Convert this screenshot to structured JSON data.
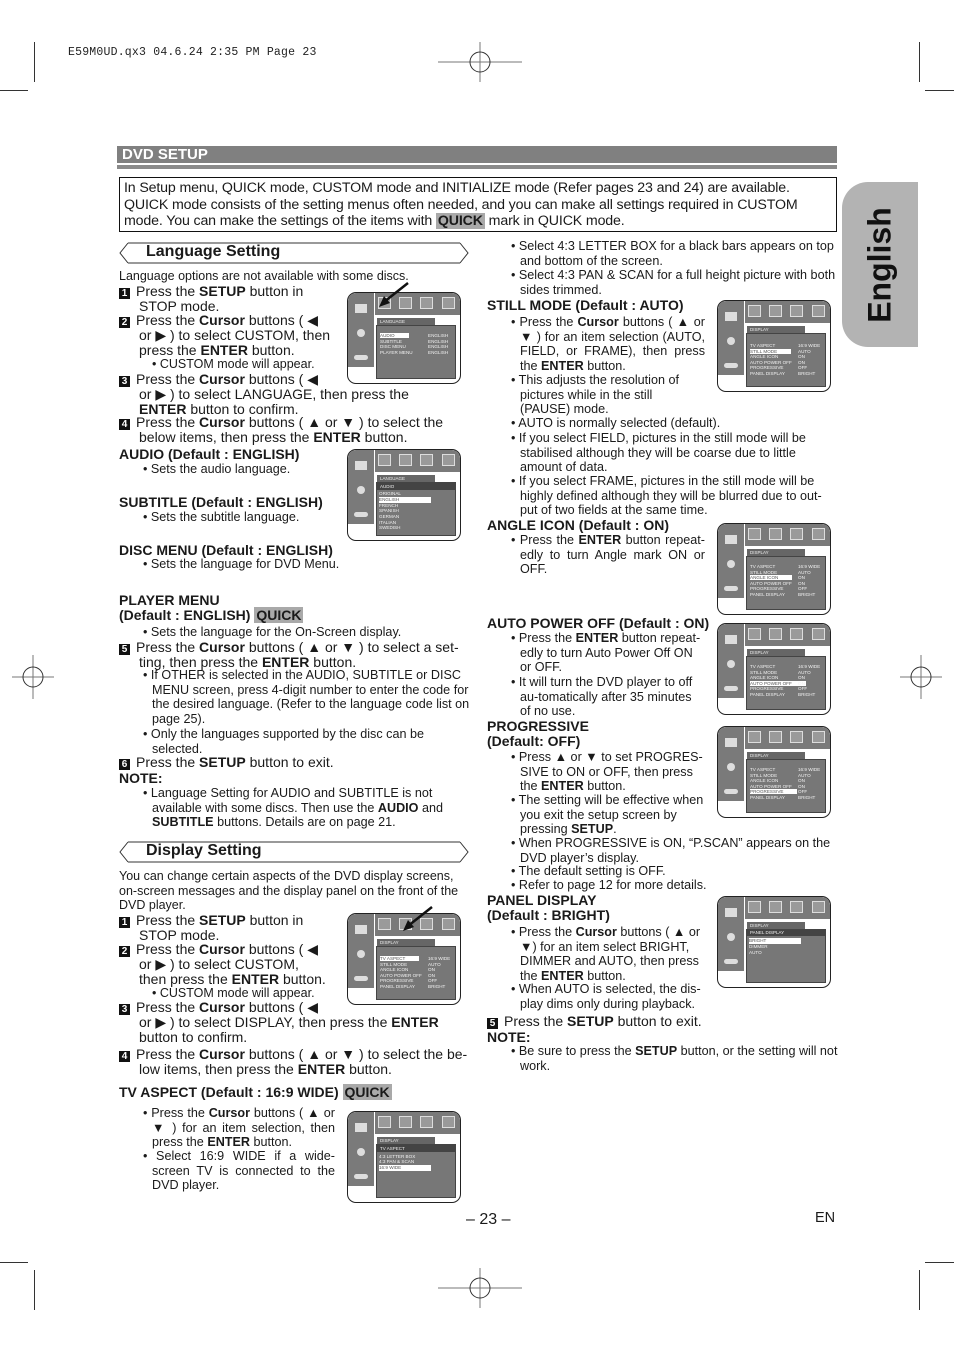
{
  "slug": "E59M0UD.qx3  04.6.24  2:35 PM  Page 23",
  "section_title": "DVD SETUP",
  "side_tab": "English",
  "intro": {
    "line1": "In Setup menu, QUICK mode, CUSTOM mode and INITIALIZE mode (Refer pages 23 and 24) are available.",
    "line2": "QUICK mode consists of the setting menus often needed, and you can make all settings required in CUSTOM",
    "line3a": "mode. You can make the settings of the items with",
    "quick": "QUICK",
    "line3b": "mark in QUICK mode."
  },
  "quick_badge": "QUICK",
  "language": {
    "title": "Language Setting",
    "note_top": "Language options are not available with some discs.",
    "steps": [
      {
        "n": "1",
        "a": "Press the ",
        "b": "SETUP",
        "c": " button in",
        "d": "STOP mode."
      },
      {
        "n": "2",
        "a": "Press the ",
        "b": "Cursor",
        "c": " buttons ( ◀",
        "d": "or ▶ ) to select CUSTOM, then",
        "e": "press the ",
        "f": "ENTER",
        "g": " button."
      },
      {
        "n": "3",
        "a": "Press the ",
        "b": "Cursor",
        "c": " buttons ( ◀",
        "d": "or ▶ ) to select LANGUAGE, then press the",
        "e": "ENTER",
        "f": " button to confirm."
      },
      {
        "n": "4",
        "a": "Press the ",
        "b": "Cursor",
        "c": " buttons ( ▲ or ▼ ) to select the",
        "d": "below items, then press the ",
        "e": "ENTER",
        "f": " button."
      },
      {
        "n": "5",
        "a": "Press the ",
        "b": "Cursor",
        "c": " buttons ( ▲ or ▼ ) to select a set-",
        "d": "ting, then press the ",
        "e": "ENTER",
        "f": " button."
      },
      {
        "n": "6",
        "a": "Press the ",
        "b": "SETUP",
        "c": " button to exit."
      }
    ],
    "custom_note": "• CUSTOM mode will appear.",
    "items": [
      {
        "head": "AUDIO",
        "def": " (Default : ENGLISH)",
        "desc": "• Sets the audio language."
      },
      {
        "head": "SUBTITLE",
        "def": " (Default : ENGLISH)",
        "desc": "• Sets the subtitle language."
      },
      {
        "head": "DISC MENU",
        "def": " (Default : ENGLISH)",
        "desc": "• Sets the language for DVD Menu."
      },
      {
        "head": "PLAYER MENU",
        "def": "(Default : ENGLISH)",
        "desc": "• Sets the language for the On-Screen display."
      }
    ],
    "step5_bullets": [
      "• If OTHER is selected in the AUDIO, SUBTITLE or DISC MENU screen, press 4-digit number to enter the code for the desired language. (Refer to the language code list on page 25).",
      "• Only the languages supported by the disc can be selected."
    ],
    "note_label": "NOTE:",
    "note": {
      "a": "• Language Setting for AUDIO and SUBTITLE is not available with some discs. Then use the ",
      "b": "AUDIO",
      "c": " and ",
      "d": "SUBTITLE",
      "e": " buttons. Details are on page 21."
    }
  },
  "display": {
    "title": "Display Setting",
    "intro": "You can change certain aspects of the DVD display screens, on-screen messages and the display panel on the front of the DVD player.",
    "steps": [
      {
        "n": "1",
        "a": "Press the ",
        "b": "SETUP",
        "c": " button in",
        "d": "STOP mode."
      },
      {
        "n": "2",
        "a": "Press the ",
        "b": "Cursor",
        "c": " buttons ( ◀",
        "d": "or ▶ ) to select CUSTOM,",
        "e": "then press the ",
        "f": "ENTER",
        "g": " button."
      },
      {
        "n": "3",
        "a": "Press the ",
        "b": "Cursor",
        "c": " buttons ( ◀",
        "d": "or ▶ ) to select DISPLAY, then press the ",
        "e": "ENTER",
        "f": "button to confirm."
      },
      {
        "n": "4",
        "a": "Press the ",
        "b": "Cursor",
        "c": " buttons ( ▲ or ▼ ) to select the be-",
        "d": "low items, then press the ",
        "e": "ENTER",
        "f": " button."
      },
      {
        "n": "5",
        "a": "Press the ",
        "b": "SETUP",
        "c": " button to exit."
      }
    ],
    "custom_note": "• CUSTOM mode will appear.",
    "tv_aspect": {
      "head": "TV ASPECT (Default : 16:9 WIDE)",
      "b1a": "• Press the ",
      "b1b": "Cursor",
      "b1c": " buttons ( ▲ or ▼ ) for an item selection, then press the ",
      "b1d": "ENTER",
      "b1e": " button.",
      "b2": "• Select 16:9 WIDE if a wide-screen TV is connected to the DVD player.",
      "b3": "• Select 4:3 LETTER BOX for a black bars appears on top and bottom of the screen.",
      "b4": "• Select 4:3 PAN & SCAN for a full height picture with both sides trimmed."
    },
    "still_mode": {
      "head": "STILL MODE (Default : AUTO)",
      "b1a": "• Press the ",
      "b1b": "Cursor",
      "b1c": " buttons ( ▲ or ▼ ) for an item selection (AUTO, FIELD, or FRAME), then press the ",
      "b1d": "ENTER",
      "b1e": " button.",
      "b2": "• This adjusts the resolution of pictures while in the still (PAUSE) mode.",
      "b3": "• AUTO is normally selected (default).",
      "b4": "• If you select FIELD, pictures in the still mode will be stabilised although they will be coarse due to little amount of data.",
      "b5": "• If you select FRAME, pictures in the still mode will be highly defined although they will be blurred due to out-put of two fields at the same time."
    },
    "angle_icon": {
      "head": "ANGLE ICON",
      "def": " (Default : ON)",
      "b1a": "• Press the ",
      "b1b": "ENTER",
      "b1c": " button repeat-edly to turn Angle mark ON or OFF."
    },
    "auto_power_off": {
      "head": "AUTO POWER OFF",
      "def": " (Default : ON)",
      "b1a": "• Press the ",
      "b1b": "ENTER",
      "b1c": " button repeat-edly to turn Auto Power Off ON or OFF.",
      "b2": "• It will turn the DVD player to off au-tomatically after 35 minutes of no use."
    },
    "progressive": {
      "head1": "PROGRESSIVE",
      "head2": "(Default: OFF)",
      "b1a": "• Press ▲ or ▼ to set PROGRES-SIVE to ON or OFF, then press the ",
      "b1b": "ENTER",
      "b1c": " button.",
      "b2a": "• The setting will be effective when you exit the setup screen by pressing ",
      "b2b": "SETUP",
      "b2c": ".",
      "b3": "• When PROGRESSIVE is ON, “P.SCAN”  appears on the DVD player’s display.",
      "b4": "• The default setting is OFF.",
      "b5": "• Refer to page 12 for more details."
    },
    "panel_display": {
      "head1": "PANEL DISPLAY",
      "head2": "(Default : BRIGHT)",
      "b1a": "• Press the ",
      "b1b": "Cursor",
      "b1c": " buttons ( ▲ or ▼) for an item select BRIGHT, DIMMER and AUTO, then press the ",
      "b1d": "ENTER",
      "b1e": " button.",
      "b2": "• When AUTO is selected, the dis-play dims only during playback."
    },
    "note_label": "NOTE:",
    "note": {
      "a": "• Be sure to press the ",
      "b": "SETUP",
      "c": " button, or the setting will not work."
    }
  },
  "osd": {
    "lang_tab": "LANGUAGE",
    "disp_tab": "DISPLAY",
    "lang_rows": [
      [
        "AUDIO",
        "ENGLISH"
      ],
      [
        "SUBTITLE",
        "ENGLISH"
      ],
      [
        "DISC MENU",
        "ENGLISH"
      ],
      [
        "PLAYER MENU",
        "ENGLISH"
      ]
    ],
    "audio_bar": "AUDIO",
    "audio_opts": [
      "ORIGINAL",
      "ENGLISH",
      "FRENCH",
      "SPANISH",
      "GERMAN",
      "ITALIAN",
      "SWEDISH"
    ],
    "disp_rows": [
      [
        "TV ASPECT",
        "16:9 WIDE"
      ],
      [
        "STILL MODE",
        "AUTO"
      ],
      [
        "ANGLE ICON",
        "ON"
      ],
      [
        "AUTO POWER OFF",
        "ON"
      ],
      [
        "PROGRESSIVE",
        "OFF"
      ],
      [
        "PANEL DISPLAY",
        "BRIGHT"
      ]
    ],
    "tv_bar": "TV ASPECT",
    "tv_opts": [
      "4:3 LETTER BOX",
      "4:3 PAN & SCAN",
      "16:9 WIDE"
    ],
    "panel_bar": "PANEL DISPLAY",
    "panel_opts": [
      "BRIGHT",
      "DIMMER",
      "AUTO"
    ]
  },
  "footer": {
    "page": "– 23 –",
    "lang": "EN"
  }
}
